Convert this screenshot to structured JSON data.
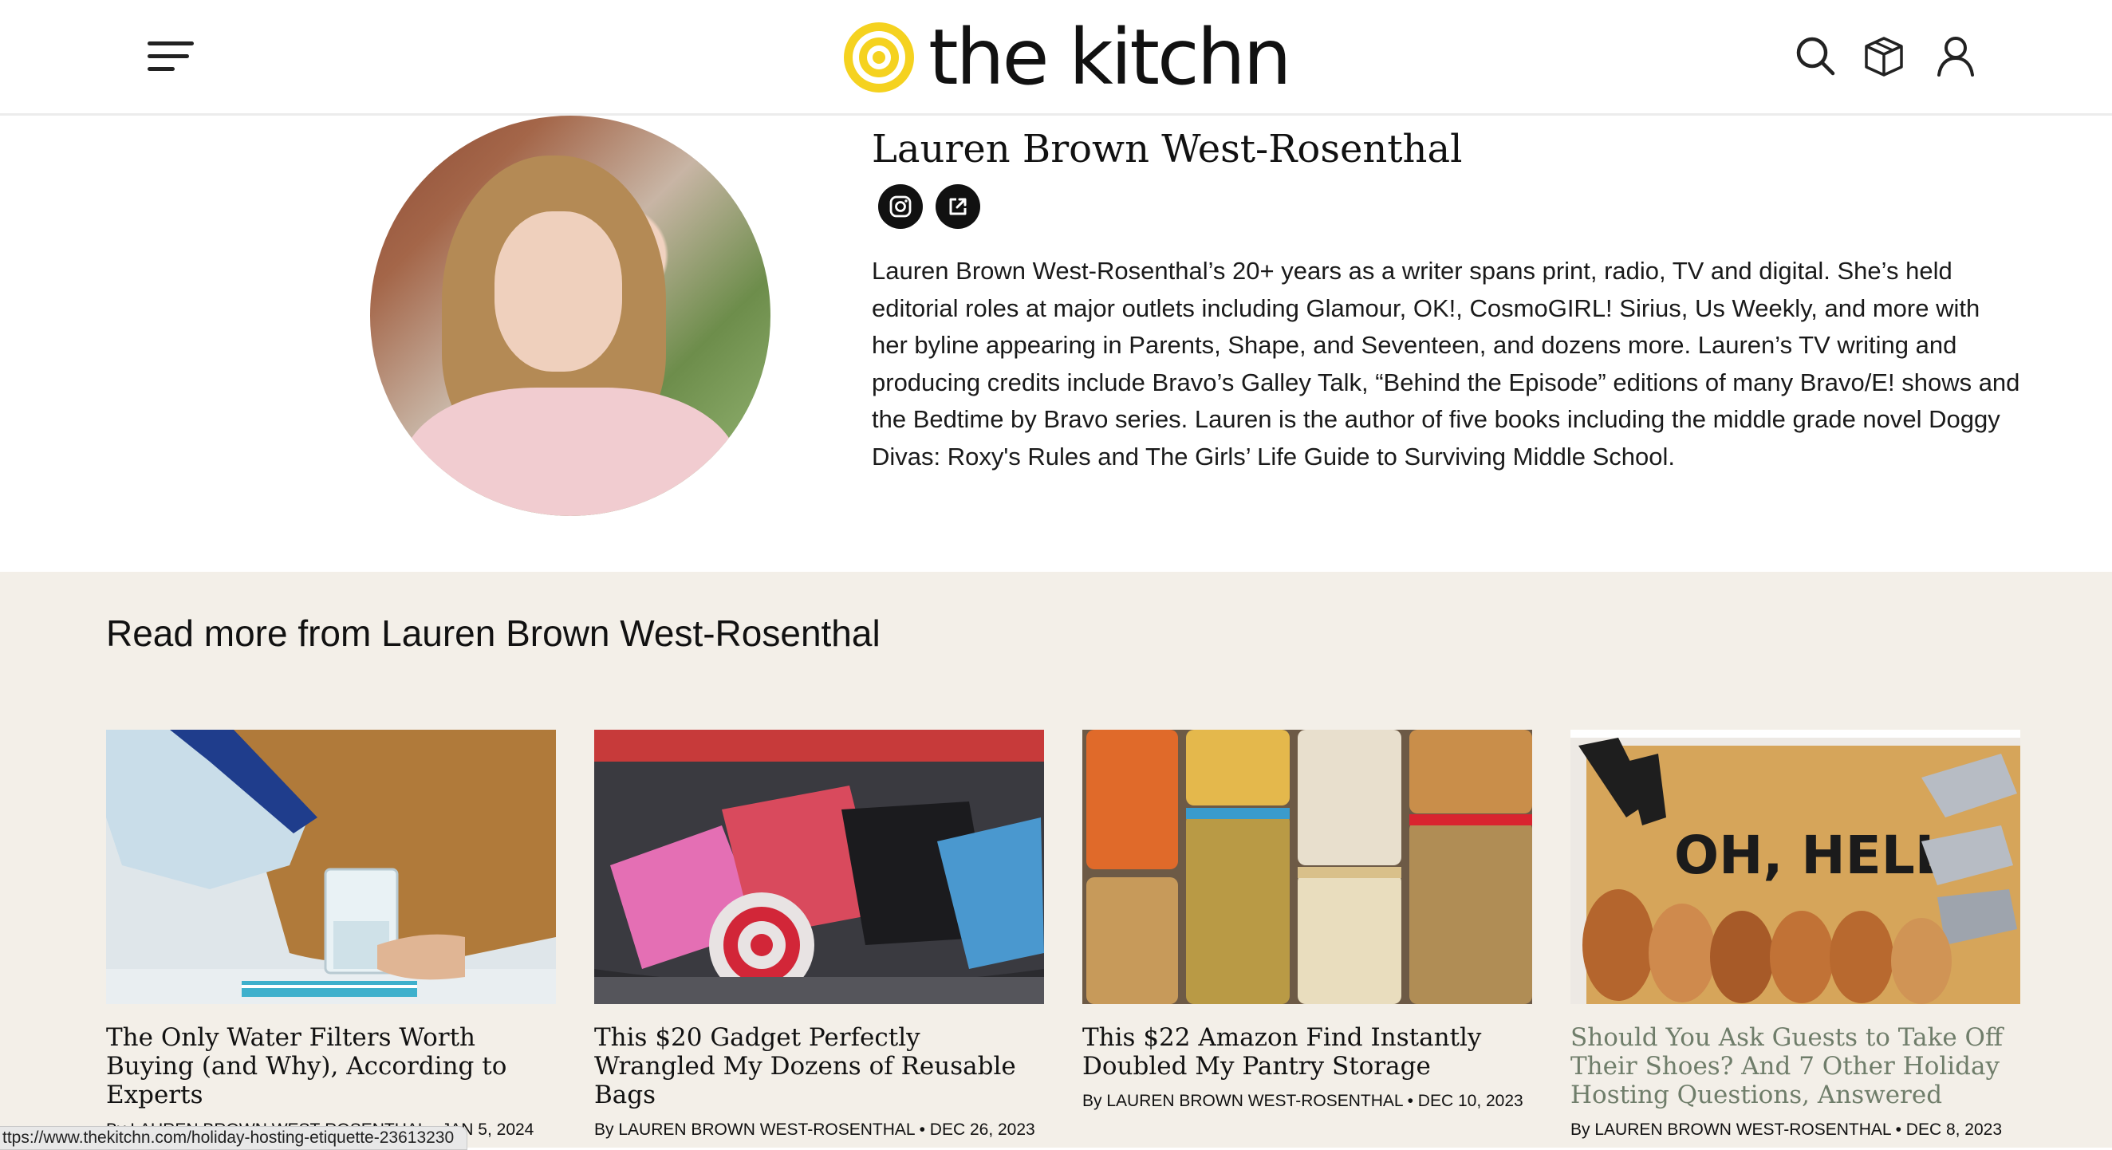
{
  "header": {
    "logo_text": "the kitchn",
    "icons": [
      "menu-icon",
      "search-icon",
      "box-icon",
      "user-icon"
    ]
  },
  "profile": {
    "name": "Lauren Brown West-Rosenthal",
    "bio": "Lauren Brown West-Rosenthal’s 20+ years as a writer spans print, radio, TV and digital. She’s held editorial roles at major outlets including Glamour, OK!, CosmoGIRL! Sirius, Us Weekly, and more with her byline appearing in Parents, Shape, and Seventeen, and dozens more. Lauren’s TV writing and producing credits include Bravo’s Galley Talk, “Behind the Episode” editions of many Bravo/E! shows and the Bedtime by Bravo series. Lauren is the author of five books including the middle grade novel Doggy Divas: Roxy's Rules and The Girls’ Life Guide to Surviving Middle School."
  },
  "more": {
    "title": "Read more from Lauren Brown West-Rosenthal",
    "articles": [
      {
        "title": "The Only Water Filters Worth Buying (and Why), According to Experts",
        "meta": "By LAUREN BROWN WEST-ROSENTHAL • JAN 5, 2024"
      },
      {
        "title": "This $20 Gadget Perfectly Wrangled My Dozens of Reusable Bags",
        "meta": "By LAUREN BROWN WEST-ROSENTHAL • DEC 26, 2023"
      },
      {
        "title": "This $22 Amazon Find Instantly Doubled My Pantry Storage",
        "meta": "By LAUREN BROWN WEST-ROSENTHAL • DEC 10, 2023"
      },
      {
        "title": "Should You Ask Guests to Take Off Their Shoes? And 7 Other Holiday Hosting Questions, Answered",
        "meta": "By LAUREN BROWN WEST-ROSENTHAL • DEC 8, 2023",
        "doormat_text": "OH, HELLO"
      }
    ]
  },
  "status_bar": {
    "url": "ttps://www.thekitchn.com/holiday-hosting-etiquette-23613230"
  },
  "colors": {
    "logo_yellow": "#f5d21f",
    "section_bg": "#f3efe8",
    "hovered_title": "#6f7d6a"
  }
}
